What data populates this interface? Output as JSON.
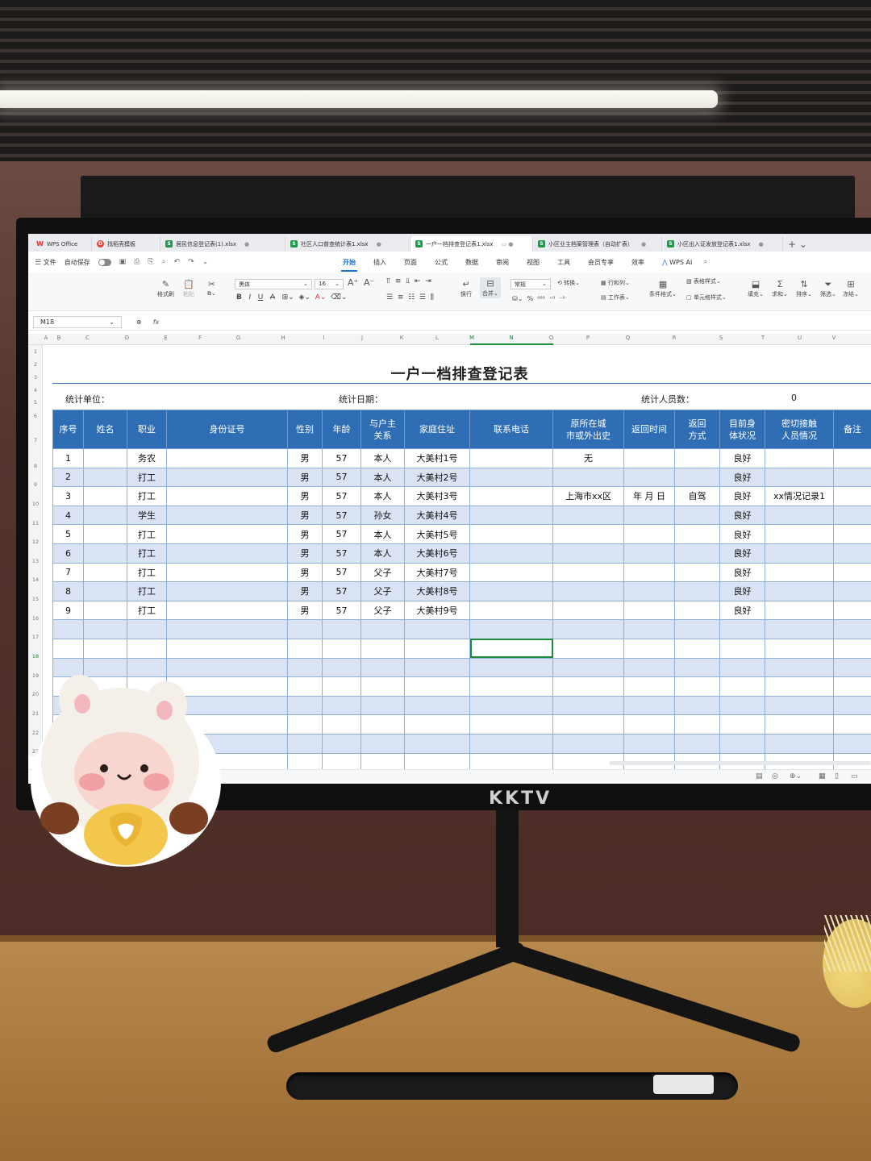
{
  "window": {
    "tabs": [
      {
        "label": "WPS Office",
        "icon": "wps-logo-icon",
        "active": false
      },
      {
        "label": "找稻壳模板",
        "icon": "docer-icon",
        "active": false
      },
      {
        "label": "居民信息登记表(1).xlsx",
        "icon": "spreadsheet-icon",
        "active": false
      },
      {
        "label": "社区人口普查统计表1.xlsx",
        "icon": "spreadsheet-icon",
        "active": false
      },
      {
        "label": "一户一档排查登记表1.xlsx",
        "icon": "spreadsheet-icon",
        "active": true
      },
      {
        "label": "小区业主档案管理表（自动扩表）",
        "icon": "spreadsheet-icon",
        "active": false
      },
      {
        "label": "小区出入证发放登记表1.xlsx",
        "icon": "spreadsheet-icon",
        "active": false
      }
    ]
  },
  "menubar": {
    "file_label": "文件",
    "autosave_label": "自动保存",
    "tabs": [
      "开始",
      "插入",
      "页面",
      "公式",
      "数据",
      "审阅",
      "视图",
      "工具",
      "会员专享",
      "效率"
    ],
    "active_tab": "开始",
    "wps_ai_label": "WPS AI"
  },
  "ribbon": {
    "format_painter": "格式刷",
    "paste": "粘贴",
    "font_name": "黑体",
    "font_size": "16",
    "wrap": "换行",
    "merge": "合并",
    "number_format": "常规",
    "convert": "转换",
    "rows_cols": "行和列",
    "worksheet": "工作表",
    "conditional_format": "条件格式",
    "table_style": "表格样式",
    "cell_style": "单元格样式",
    "fill": "填充",
    "sum": "求和",
    "sort": "排序",
    "filter": "筛选",
    "freeze": "冻结"
  },
  "formula_bar": {
    "name_box": "M18",
    "fx_label": "fx",
    "value": ""
  },
  "columns": [
    "A",
    "B",
    "C",
    "D",
    "E",
    "F",
    "G",
    "H",
    "I",
    "J",
    "K",
    "L",
    "M",
    "N",
    "O",
    "P",
    "Q",
    "R",
    "S",
    "T",
    "U",
    "V"
  ],
  "selected_columns": [
    "M",
    "N"
  ],
  "row_numbers": [
    "1",
    "2",
    "3",
    "4",
    "5",
    "6",
    "7",
    "8",
    "9",
    "10",
    "11",
    "12",
    "13",
    "14",
    "15",
    "16",
    "17",
    "18",
    "19",
    "20",
    "21",
    "22",
    "23"
  ],
  "selected_row": "18",
  "sheet": {
    "title": "一户一档排查登记表",
    "unit_label": "统计单位：",
    "date_label": "统计日期：",
    "count_label": "统计人员数：",
    "count_value": "0",
    "headers": [
      "序号",
      "姓名",
      "职业",
      "身份证号",
      "性别",
      "年龄",
      "与户主\n关系",
      "家庭住址",
      "联系电话",
      "原所在城\n市或外出史",
      "返回时间",
      "返回\n方式",
      "目前身\n体状况",
      "密切接触\n人员情况",
      "备注"
    ],
    "rows": [
      [
        "1",
        "",
        "务农",
        "",
        "男",
        "57",
        "本人",
        "大美村1号",
        "",
        "无",
        "",
        "",
        "良好",
        "",
        ""
      ],
      [
        "2",
        "",
        "打工",
        "",
        "男",
        "57",
        "本人",
        "大美村2号",
        "",
        "",
        "",
        "",
        "良好",
        "",
        ""
      ],
      [
        "3",
        "",
        "打工",
        "",
        "男",
        "57",
        "本人",
        "大美村3号",
        "",
        "上海市xx区",
        "年  月  日",
        "自驾",
        "良好",
        "xx情况记录1",
        ""
      ],
      [
        "4",
        "",
        "学生",
        "",
        "男",
        "57",
        "孙女",
        "大美村4号",
        "",
        "",
        "",
        "",
        "良好",
        "",
        ""
      ],
      [
        "5",
        "",
        "打工",
        "",
        "男",
        "57",
        "本人",
        "大美村5号",
        "",
        "",
        "",
        "",
        "良好",
        "",
        ""
      ],
      [
        "6",
        "",
        "打工",
        "",
        "男",
        "57",
        "本人",
        "大美村6号",
        "",
        "",
        "",
        "",
        "良好",
        "",
        ""
      ],
      [
        "7",
        "",
        "打工",
        "",
        "男",
        "57",
        "父子",
        "大美村7号",
        "",
        "",
        "",
        "",
        "良好",
        "",
        ""
      ],
      [
        "8",
        "",
        "打工",
        "",
        "男",
        "57",
        "父子",
        "大美村8号",
        "",
        "",
        "",
        "",
        "良好",
        "",
        ""
      ],
      [
        "9",
        "",
        "打工",
        "",
        "男",
        "57",
        "父子",
        "大美村9号",
        "",
        "",
        "",
        "",
        "良好",
        "",
        ""
      ],
      [
        "",
        "",
        "",
        "",
        "",
        "",
        "",
        "",
        "",
        "",
        "",
        "",
        "",
        "",
        ""
      ],
      [
        "",
        "",
        "",
        "",
        "",
        "",
        "",
        "",
        "",
        "",
        "",
        "",
        "",
        "",
        ""
      ],
      [
        "",
        "",
        "",
        "",
        "",
        "",
        "",
        "",
        "",
        "",
        "",
        "",
        "",
        "",
        ""
      ],
      [
        "",
        "",
        "",
        "",
        "",
        "",
        "",
        "",
        "",
        "",
        "",
        "",
        "",
        "",
        ""
      ],
      [
        "",
        "",
        "",
        "",
        "",
        "",
        "",
        "",
        "",
        "",
        "",
        "",
        "",
        "",
        ""
      ],
      [
        "",
        "",
        "",
        "",
        "",
        "",
        "",
        "",
        "",
        "",
        "",
        "",
        "",
        "",
        ""
      ],
      [
        "",
        "",
        "",
        "",
        "",
        "",
        "",
        "",
        "",
        "",
        "",
        "",
        "",
        "",
        ""
      ],
      [
        "",
        "",
        "",
        "",
        "",
        "",
        "",
        "",
        "",
        "",
        "",
        "",
        "",
        "",
        ""
      ]
    ]
  },
  "monitor_brand": "KKTV",
  "colors": {
    "header_blue": "#2f6db5",
    "alt_row": "#d9e3f3",
    "selection_green": "#1d8b3c",
    "accent_blue": "#1d73d9"
  }
}
